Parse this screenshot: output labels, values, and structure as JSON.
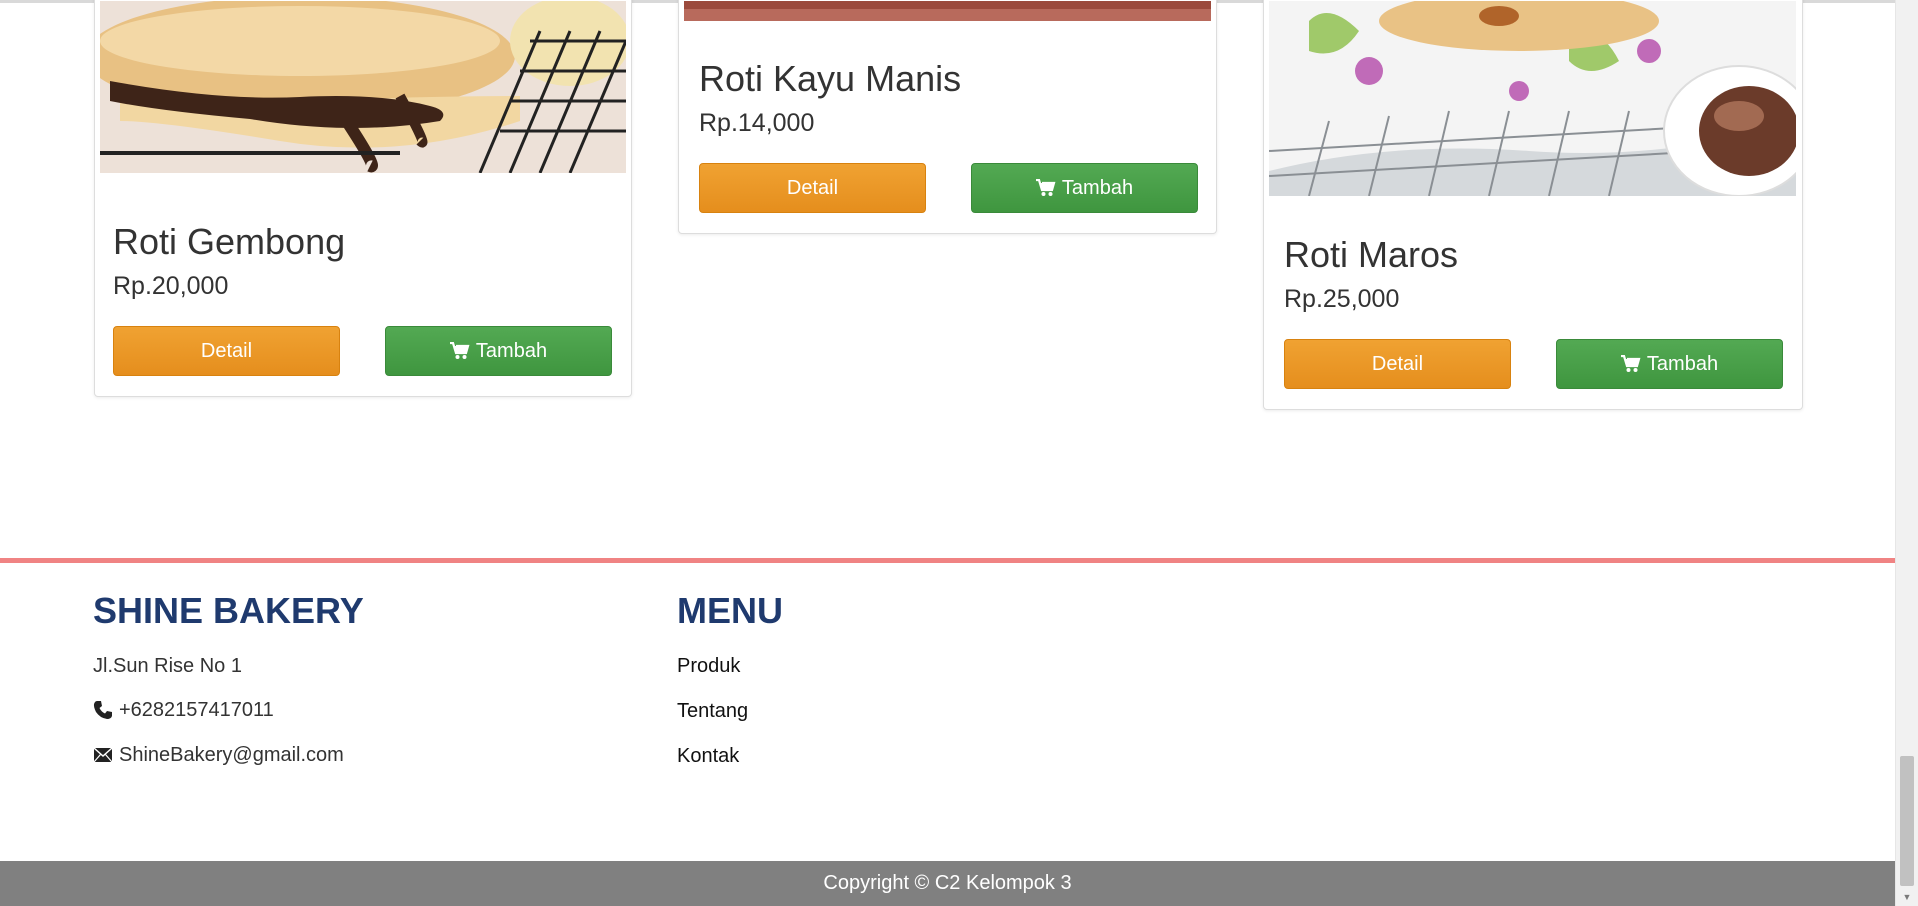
{
  "products": [
    {
      "name": "Roti Gembong",
      "price": "Rp.20,000",
      "detail_label": "Detail",
      "add_label": "Tambah"
    },
    {
      "name": "Roti Kayu Manis",
      "price": "Rp.14,000",
      "detail_label": "Detail",
      "add_label": "Tambah"
    },
    {
      "name": "Roti Maros",
      "price": "Rp.25,000",
      "detail_label": "Detail",
      "add_label": "Tambah"
    }
  ],
  "footer": {
    "brand": "SHINE BAKERY",
    "address": "Jl.Sun Rise No 1",
    "phone": "+6282157417011",
    "email": "ShineBakery@gmail.com",
    "menu_heading": "MENU",
    "menu": [
      "Produk",
      "Tentang",
      "Kontak"
    ]
  },
  "copyright": "Copyright © C2 Kelompok 3",
  "icons": {
    "cart": "cart-icon",
    "phone": "phone-icon",
    "email": "envelope-icon"
  },
  "colors": {
    "detail_button": "#ec9826",
    "add_button": "#48a048",
    "footer_rule": "#f08383",
    "footer_heading": "#1f3a6e",
    "copyright_bar": "#808080"
  }
}
